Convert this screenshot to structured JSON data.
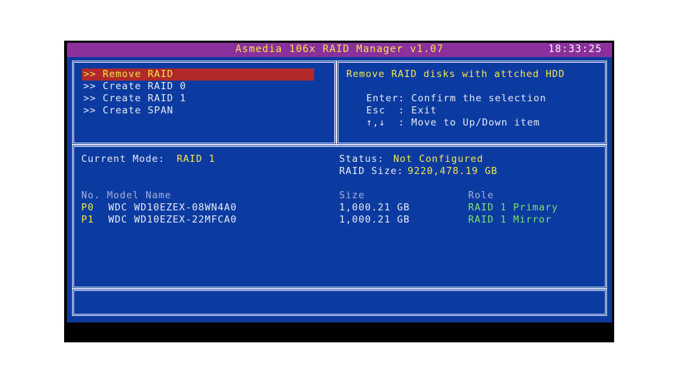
{
  "titlebar": {
    "title": "Asmedia 106x RAID Manager v1.07",
    "clock": "18:33:25"
  },
  "menu": {
    "items": [
      {
        "label": ">> Remove RAID",
        "selected": true
      },
      {
        "label": ">> Create RAID 0",
        "selected": false
      },
      {
        "label": ">> Create RAID 1",
        "selected": false
      },
      {
        "label": ">> Create SPAN",
        "selected": false
      }
    ]
  },
  "help": {
    "heading": "Remove RAID disks with attched HDD",
    "lines": [
      "Enter: Confirm the selection",
      "Esc  : Exit",
      "↑,↓  : Move to Up/Down item"
    ]
  },
  "info": {
    "mode_label": "Current Mode:",
    "mode_value": "RAID 1",
    "status_label": "Status:",
    "status_value": "Not Configured",
    "size_label": "RAID Size:",
    "size_value": "9220,478.19 GB",
    "columns": {
      "no_model": "No. Model Name",
      "size": "Size",
      "role": "Role"
    },
    "disks": [
      {
        "no": "P0",
        "model": "WDC WD10EZEX-08WN4A0",
        "size": "1,000.21 GB",
        "role": "RAID 1 Primary"
      },
      {
        "no": "P1",
        "model": "WDC WD10EZEX-22MFCA0",
        "size": "1,000.21 GB",
        "role": "RAID 1 Mirror"
      }
    ]
  },
  "colors": {
    "background": "#0b3aa0",
    "titlebar": "#8a2f9c",
    "highlight": "#b0282a",
    "text_yellow": "#f4e84a",
    "text_green": "#7ee36a"
  }
}
